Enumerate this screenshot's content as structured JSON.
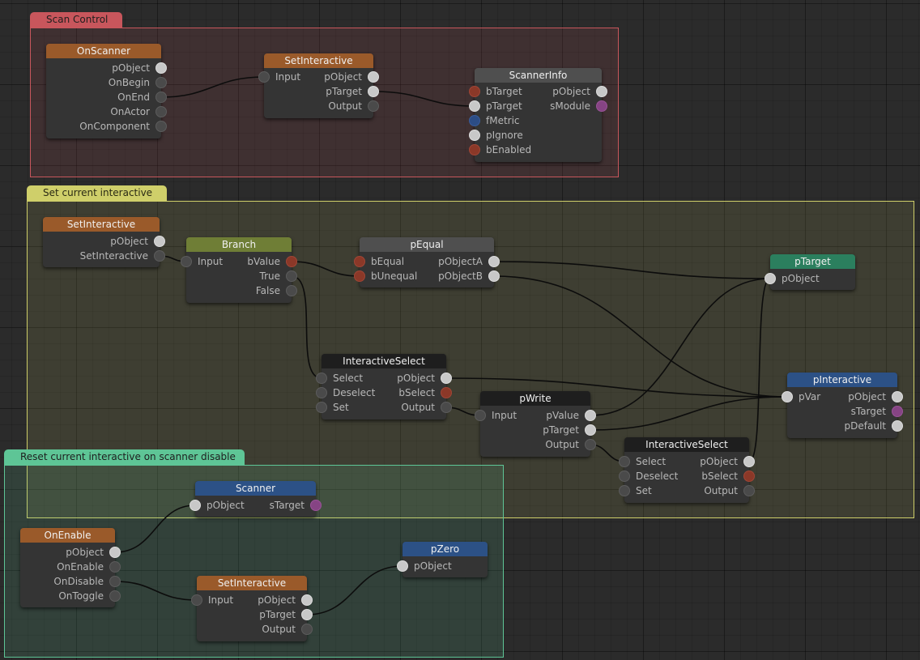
{
  "colors": {
    "header_orange": "#9a5a2a",
    "header_olive": "#6f7e36",
    "header_gray": "#4f4f4f",
    "header_black": "#1e1e1e",
    "header_blue": "#2c5186",
    "header_green": "#2b7f5e",
    "group_scan": "#c8565c",
    "group_set": "#cfcf6a",
    "group_reset": "#5ec596"
  },
  "groups": {
    "scan_control": "Scan Control",
    "set_current": "Set current interactive",
    "reset_current": "Reset current interactive on scanner disable"
  },
  "nodes": {
    "onscanner": {
      "title": "OnScanner",
      "outputs": [
        "pObject",
        "OnBegin",
        "OnEnd",
        "OnActor",
        "OnComponent"
      ]
    },
    "setinteractive1": {
      "title": "SetInteractive",
      "inputs": [
        "Input"
      ],
      "outputs": [
        "pObject",
        "pTarget",
        "Output"
      ]
    },
    "scannerinfo": {
      "title": "ScannerInfo",
      "inputs": [
        "bTarget",
        "pTarget",
        "fMetric",
        "pIgnore",
        "bEnabled"
      ],
      "outputs": [
        "pObject",
        "sModule"
      ]
    },
    "setinteractive2": {
      "title": "SetInteractive",
      "outputs": [
        "pObject",
        "SetInteractive"
      ]
    },
    "branch": {
      "title": "Branch",
      "inputs": [
        "Input"
      ],
      "outputs": [
        "bValue",
        "True",
        "False"
      ]
    },
    "pequal": {
      "title": "pEqual",
      "inputs": [
        "bEqual",
        "bUnequal"
      ],
      "outputs": [
        "pObjectA",
        "pObjectB"
      ]
    },
    "ptarget": {
      "title": "pTarget",
      "inputs": [
        "pObject"
      ]
    },
    "interactiveselect1": {
      "title": "InteractiveSelect",
      "inputs": [
        "Select",
        "Deselect",
        "Set"
      ],
      "outputs": [
        "pObject",
        "bSelect",
        "Output"
      ]
    },
    "pwrite": {
      "title": "pWrite",
      "inputs": [
        "Input"
      ],
      "outputs": [
        "pValue",
        "pTarget",
        "Output"
      ]
    },
    "pinteractive": {
      "title": "pInteractive",
      "inputs": [
        "pVar"
      ],
      "outputs": [
        "pObject",
        "sTarget",
        "pDefault"
      ]
    },
    "interactiveselect2": {
      "title": "InteractiveSelect",
      "inputs": [
        "Select",
        "Deselect",
        "Set"
      ],
      "outputs": [
        "pObject",
        "bSelect",
        "Output"
      ]
    },
    "scanner": {
      "title": "Scanner",
      "inputs": [
        "pObject"
      ],
      "outputs": [
        "sTarget"
      ]
    },
    "onenable": {
      "title": "OnEnable",
      "outputs": [
        "pObject",
        "OnEnable",
        "OnDisable",
        "OnToggle"
      ]
    },
    "setinteractive3": {
      "title": "SetInteractive",
      "inputs": [
        "Input"
      ],
      "outputs": [
        "pObject",
        "pTarget",
        "Output"
      ]
    },
    "pzero": {
      "title": "pZero",
      "inputs": [
        "pObject"
      ]
    }
  }
}
